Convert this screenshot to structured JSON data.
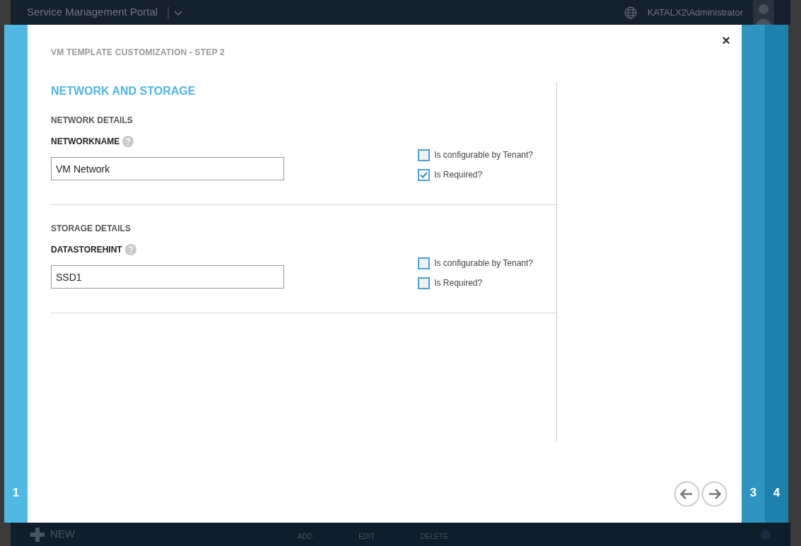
{
  "portal": {
    "title": "Service Management Portal",
    "user": "KATALX2\\Administrator"
  },
  "footer": {
    "new_label": "NEW",
    "actions": [
      "ADD",
      "EDIT",
      "DELETE"
    ]
  },
  "wizard": {
    "title": "VM TEMPLATE CUSTOMIZATION - STEP 2",
    "close": "×",
    "heading": "NETWORK AND STORAGE",
    "sections": [
      {
        "title": "NETWORK DETAILS",
        "field_label": "NETWORKNAME",
        "value": "VM Network",
        "options": [
          {
            "label": "Is configurable by Tenant?",
            "checked": false
          },
          {
            "label": "Is Required?",
            "checked": true
          }
        ]
      },
      {
        "title": "STORAGE DETAILS",
        "field_label": "DATASTOREHINT",
        "value": "SSD1",
        "options": [
          {
            "label": "Is configurable by Tenant?",
            "checked": false
          },
          {
            "label": "Is Required?",
            "checked": false
          }
        ]
      }
    ],
    "steps_left": [
      {
        "label": "1",
        "selected": false
      }
    ],
    "steps_right": [
      {
        "label": "3",
        "selected": false
      },
      {
        "label": "4",
        "selected": false
      }
    ]
  }
}
